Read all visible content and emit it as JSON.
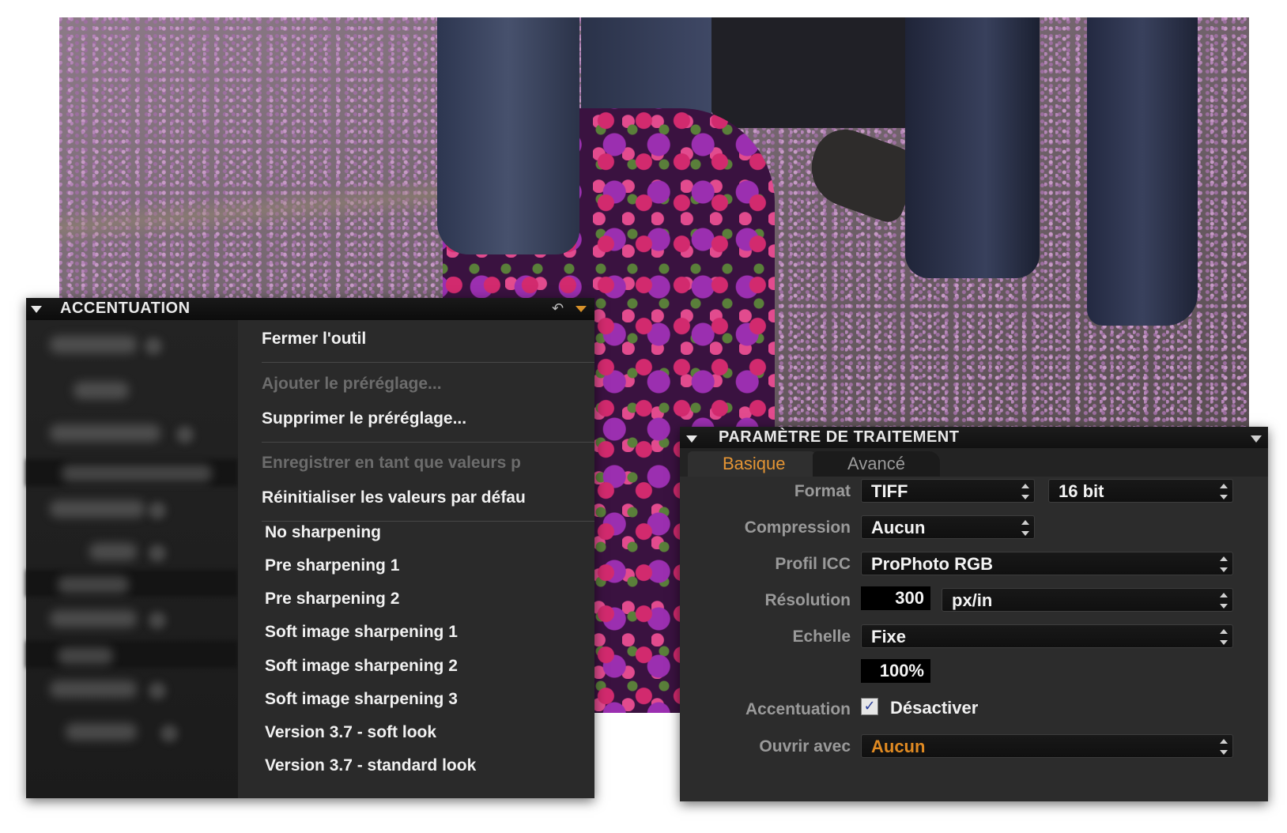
{
  "accentuation_panel": {
    "title": "ACCENTUATION",
    "menu": {
      "close_tool": "Fermer l'outil",
      "add_preset": "Ajouter le préréglage...",
      "delete_preset": "Supprimer le préréglage...",
      "save_defaults": "Enregistrer en tant que valeurs p",
      "reset_defaults": "Réinitialiser les valeurs par défau",
      "presets": [
        "No sharpening",
        "Pre sharpening 1",
        "Pre sharpening 2",
        "Soft image sharpening 1",
        "Soft image sharpening 2",
        "Soft image sharpening 3",
        "Version 3.7 - soft look",
        "Version 3.7 - standard look"
      ]
    }
  },
  "processing_panel": {
    "title": "PARAMÈTRE DE TRAITEMENT",
    "tabs": [
      "Basique",
      "Avancé"
    ],
    "active_tab": "Basique",
    "fields": {
      "format_label": "Format",
      "format_value": "TIFF",
      "bitdepth_value": "16 bit",
      "compression_label": "Compression",
      "compression_value": "Aucun",
      "icc_label": "Profil ICC",
      "icc_value": "ProPhoto RGB",
      "resolution_label": "Résolution",
      "resolution_value": "300",
      "resolution_unit": "px/in",
      "scale_label": "Echelle",
      "scale_value": "Fixe",
      "scale_percent": "100%",
      "sharpening_label": "Accentuation",
      "sharpening_checkbox_label": "Désactiver",
      "sharpening_checked": true,
      "open_with_label": "Ouvrir avec",
      "open_with_value": "Aucun"
    }
  },
  "colors": {
    "accent_orange": "#e59534",
    "panel_bg": "#2b2b2b"
  }
}
